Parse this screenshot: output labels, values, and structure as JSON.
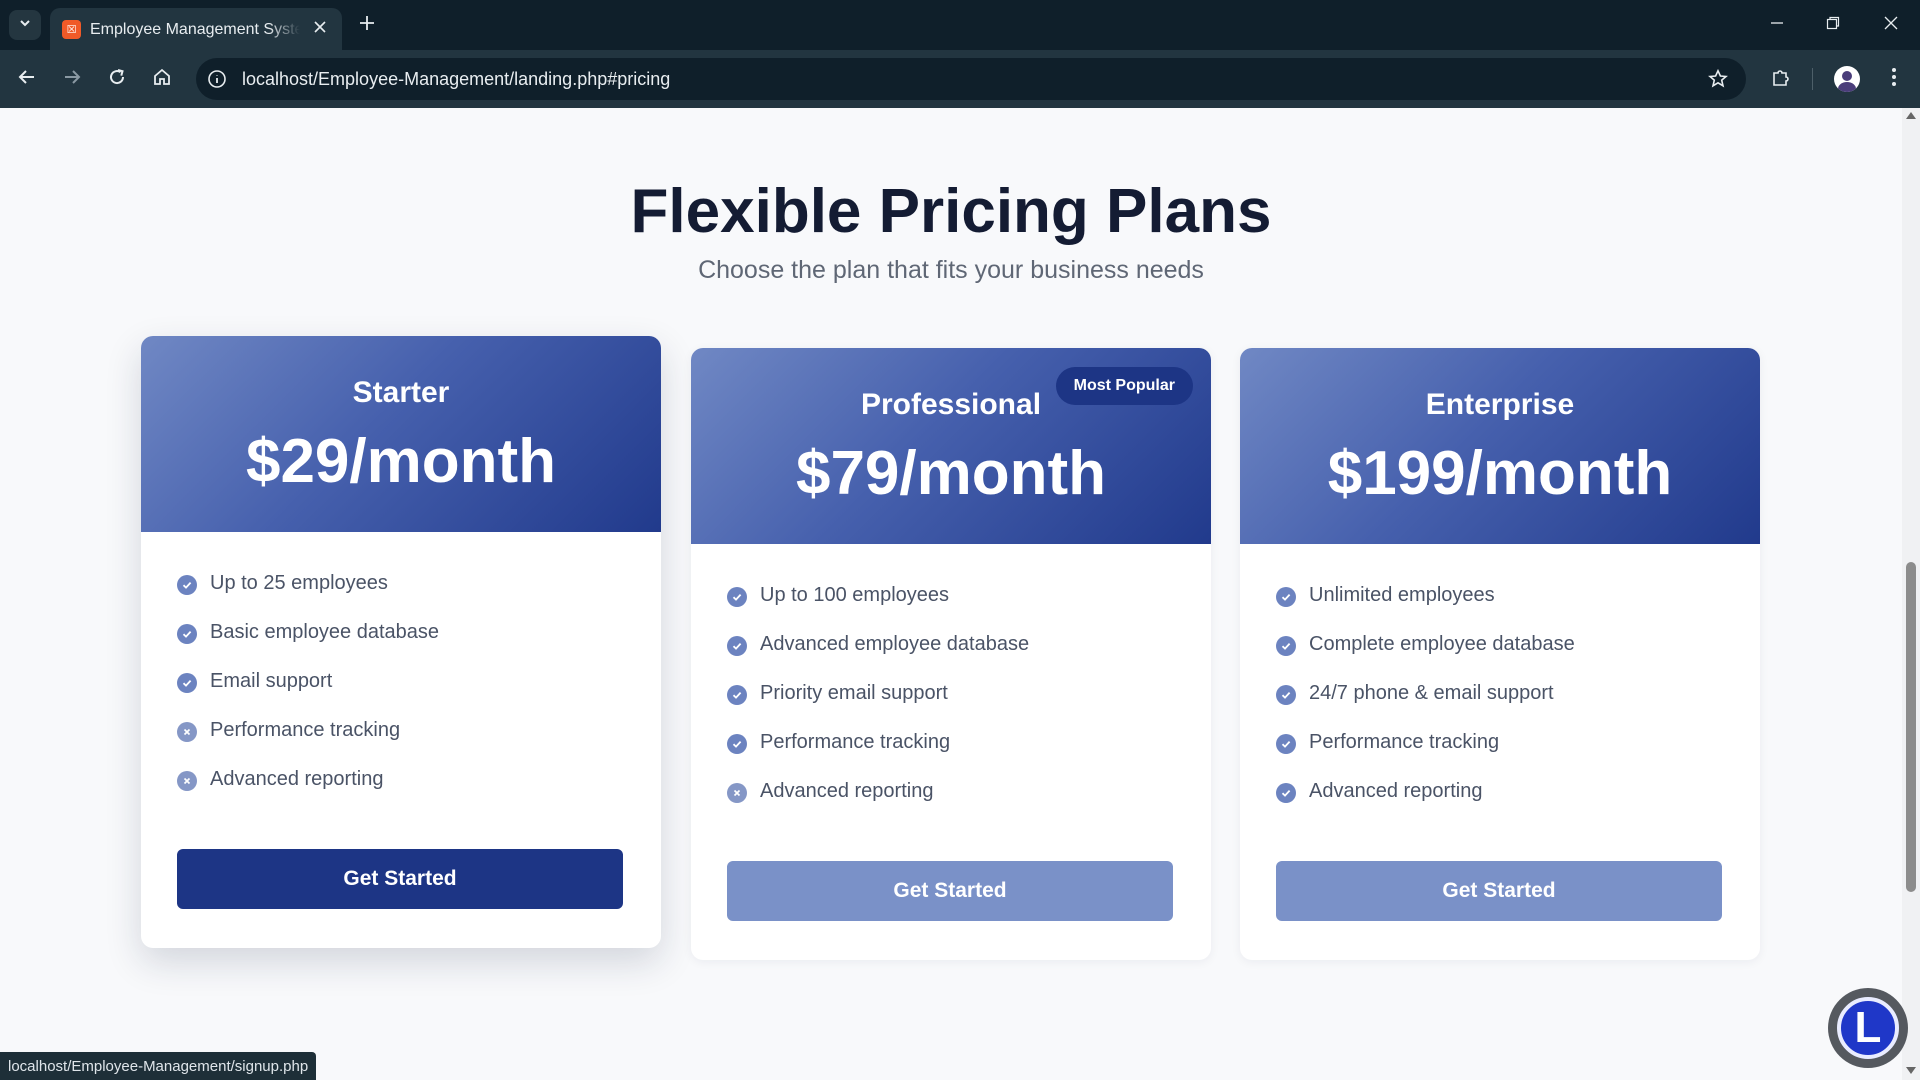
{
  "browser": {
    "tab_title": "Employee Management System",
    "url": "localhost/Employee-Management/landing.php#pricing",
    "favicon_icon": "xampp-icon",
    "status_url": "localhost/Employee-Management/signup.php"
  },
  "pricing": {
    "title": "Flexible Pricing Plans",
    "subtitle": "Choose the plan that fits your business needs",
    "plans": [
      {
        "name": "Starter",
        "price": "$29/month",
        "badge": "",
        "features": [
          {
            "text": "Up to 25 employees",
            "included": true
          },
          {
            "text": "Basic employee database",
            "included": true
          },
          {
            "text": "Email support",
            "included": true
          },
          {
            "text": "Performance tracking",
            "included": false
          },
          {
            "text": "Advanced reporting",
            "included": false
          }
        ],
        "cta": "Get Started"
      },
      {
        "name": "Professional",
        "price": "$79/month",
        "badge": "Most Popular",
        "features": [
          {
            "text": "Up to 100 employees",
            "included": true
          },
          {
            "text": "Advanced employee database",
            "included": true
          },
          {
            "text": "Priority email support",
            "included": true
          },
          {
            "text": "Performance tracking",
            "included": true
          },
          {
            "text": "Advanced reporting",
            "included": false
          }
        ],
        "cta": "Get Started"
      },
      {
        "name": "Enterprise",
        "price": "$199/month",
        "badge": "",
        "features": [
          {
            "text": "Unlimited employees",
            "included": true
          },
          {
            "text": "Complete employee database",
            "included": true
          },
          {
            "text": "24/7 phone & email support",
            "included": true
          },
          {
            "text": "Performance tracking",
            "included": true
          },
          {
            "text": "Advanced reporting",
            "included": true
          }
        ],
        "cta": "Get Started"
      }
    ]
  },
  "launcher": {
    "label": "L"
  },
  "colors": {
    "accent": "#1d3585",
    "muted_button": "#7a91c8",
    "heading": "#141c33",
    "check": "#6c83c0"
  }
}
